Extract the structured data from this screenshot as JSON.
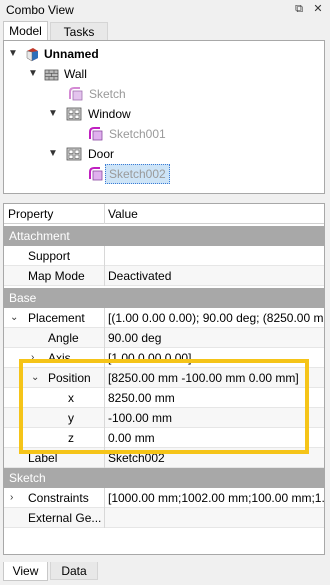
{
  "window": {
    "title": "Combo View",
    "float_icon": "float-icon",
    "close_icon": "close-icon"
  },
  "top_tabs": [
    {
      "label": "Model",
      "active": true
    },
    {
      "label": "Tasks",
      "active": false
    }
  ],
  "tree": {
    "root": "Unnamed",
    "wall": "Wall",
    "wall_sketch": "Sketch",
    "window": "Window",
    "window_sketch": "Sketch001",
    "door": "Door",
    "door_sketch": "Sketch002"
  },
  "properties": {
    "header": {
      "property": "Property",
      "value": "Value"
    },
    "groups": {
      "attachment": "Attachment",
      "base": "Base",
      "sketch": "Sketch"
    },
    "support": {
      "name": "Support",
      "value": ""
    },
    "map_mode": {
      "name": "Map Mode",
      "value": "Deactivated"
    },
    "placement": {
      "name": "Placement",
      "value": "[(1.00 0.00 0.00); 90.00 deg; (8250.00 mm"
    },
    "angle": {
      "name": "Angle",
      "value": "90.00 deg"
    },
    "axis": {
      "name": "Axis",
      "value": "[1.00 0.00 0.00]"
    },
    "position": {
      "name": "Position",
      "value": "[8250.00 mm  -100.00 mm  0.00 mm]"
    },
    "x": {
      "name": "x",
      "value": "8250.00 mm"
    },
    "y": {
      "name": "y",
      "value": "-100.00 mm"
    },
    "z": {
      "name": "z",
      "value": "0.00 mm"
    },
    "label": {
      "name": "Label",
      "value": "Sketch002"
    },
    "constraints": {
      "name": "Constraints",
      "value": "[1000.00 mm;1002.00 mm;100.00 mm;1..."
    },
    "external_geometry": {
      "name": "External Ge...",
      "value": ""
    }
  },
  "bottom_tabs": [
    {
      "label": "View",
      "active": true
    },
    {
      "label": "Data",
      "active": false
    }
  ],
  "colors": {
    "highlight": "#f5c418",
    "group_bg": "#a8a8a8",
    "selection": "#cde4f7"
  }
}
